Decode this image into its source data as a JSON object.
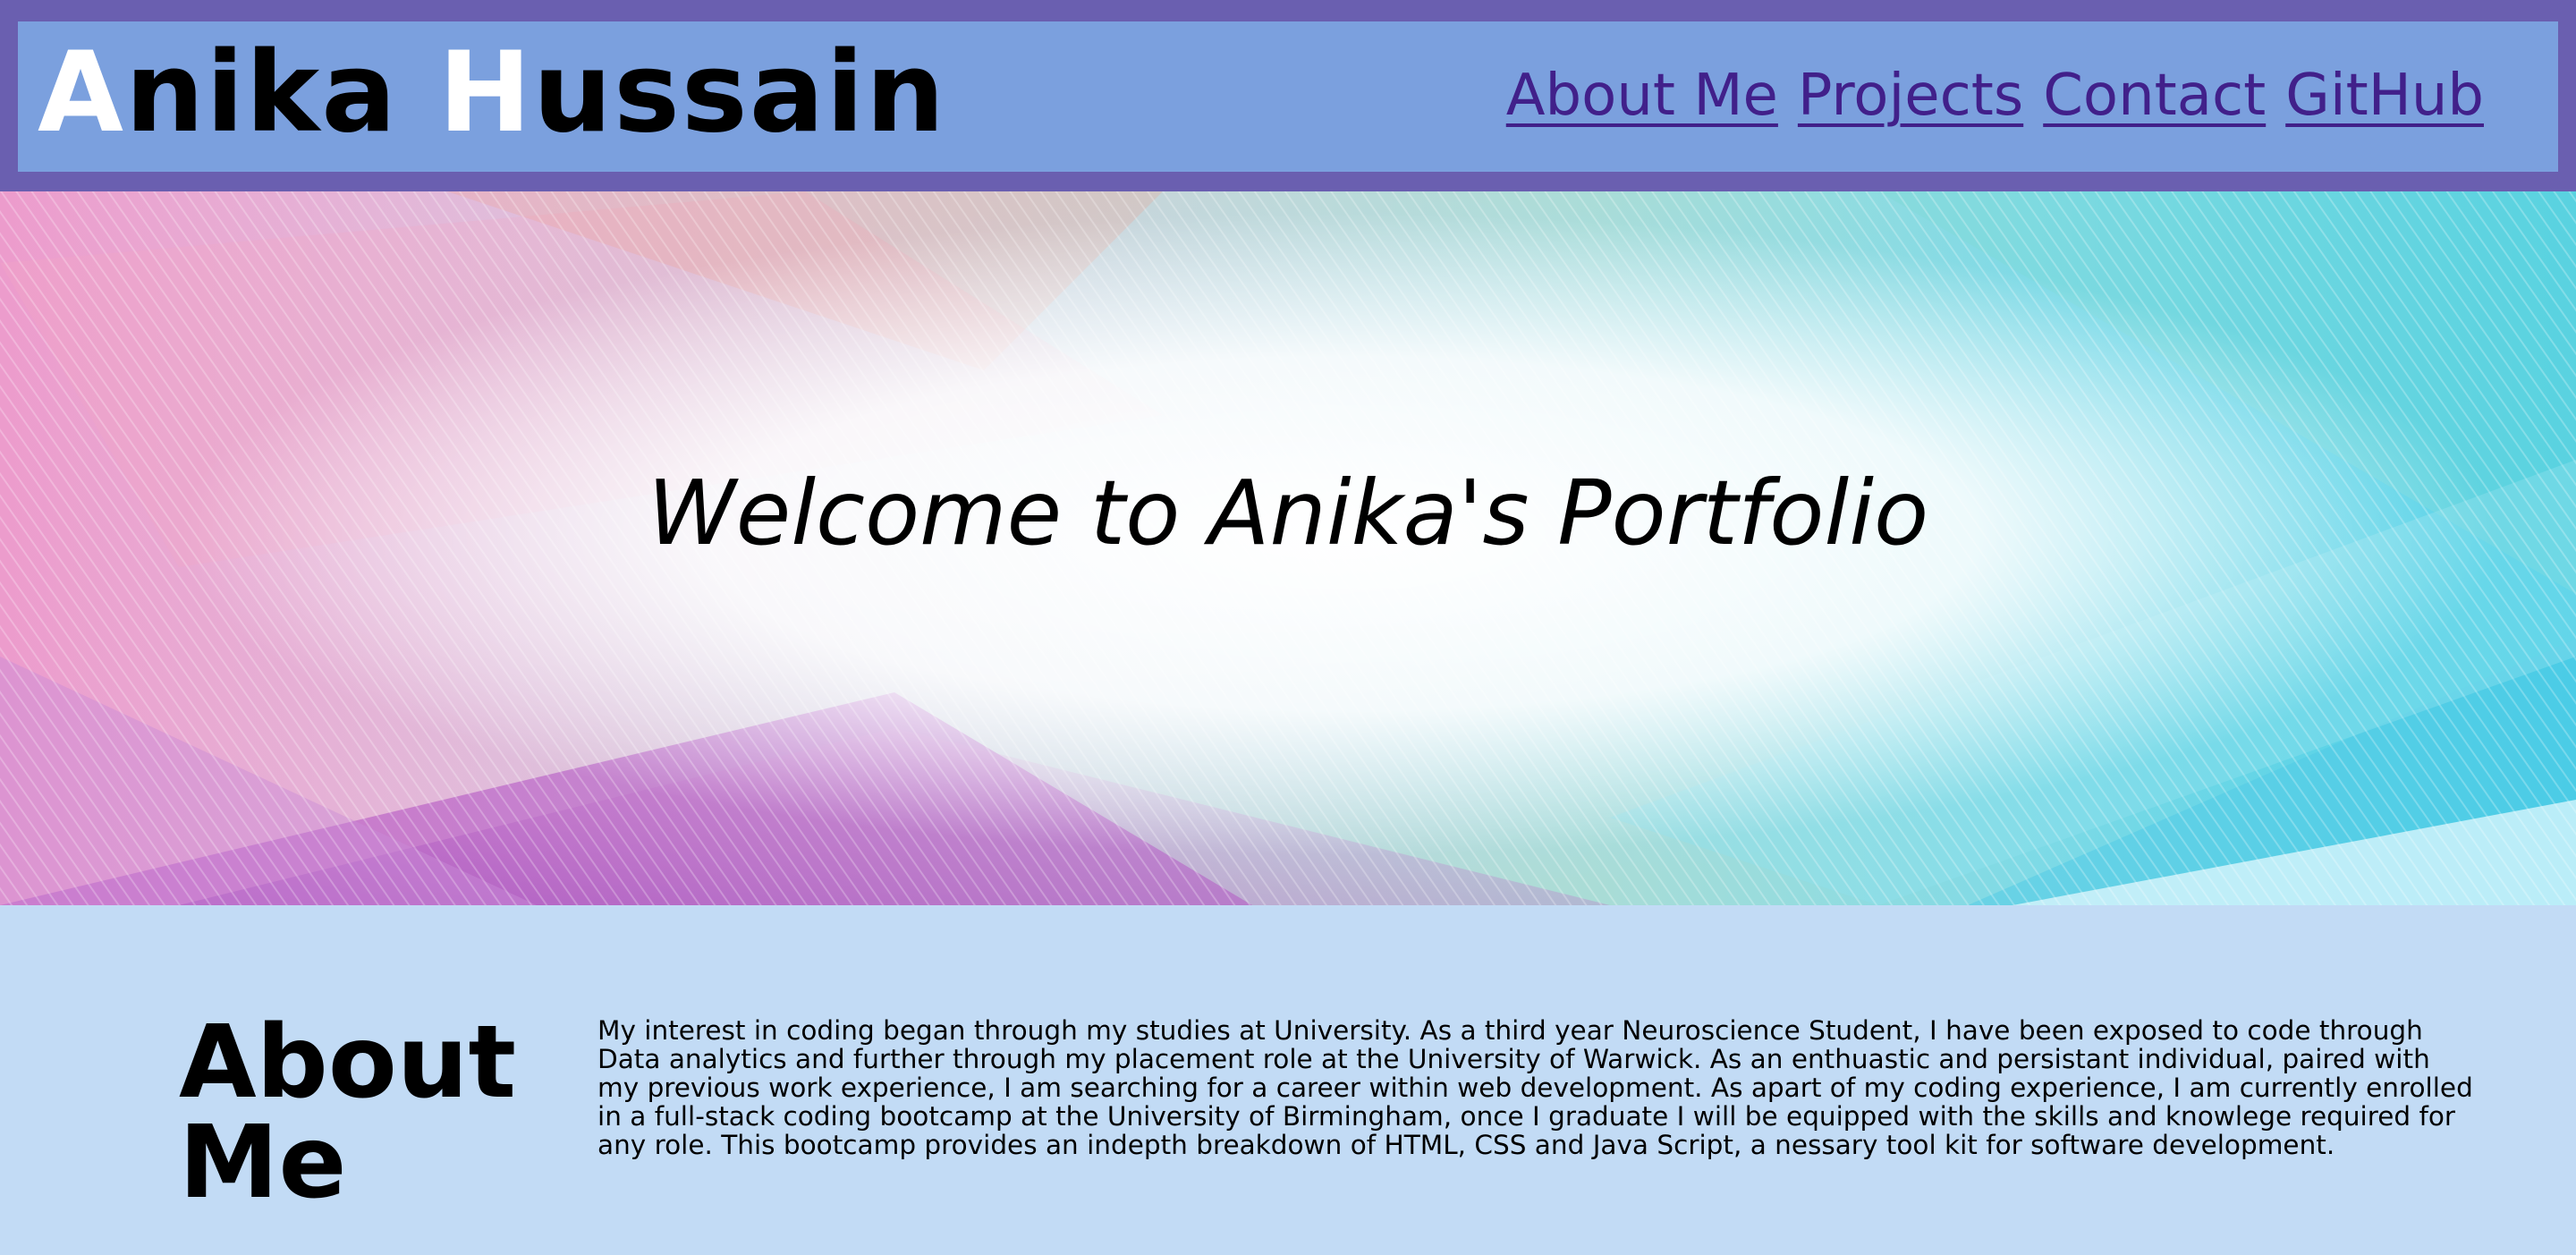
{
  "header": {
    "name_first_initial": "A",
    "name_first_rest": "nika ",
    "name_last_initial": "H",
    "name_last_rest": "ussain",
    "nav": [
      {
        "label": "About Me"
      },
      {
        "label": "Projects"
      },
      {
        "label": "Contact"
      },
      {
        "label": "GitHub"
      }
    ]
  },
  "hero": {
    "title": "Welcome to Anika's Portfolio"
  },
  "about": {
    "heading": "About Me",
    "body": "My interest in coding began through my studies at University. As a third year Neuroscience Student, I have been exposed to code through Data analytics and further through my placement role at the University of Warwick. As an enthuastic and persistant individual, paired with my previous work experience, I am searching for a career within web development. As apart of my coding experience, I am currently enrolled in a full-stack coding bootcamp at the University of Birmingham, once I graduate I will be equipped with the skills and knowlege required for any role. This bootcamp provides an indepth breakdown of HTML, CSS and Java Script, a nessary tool kit for software development."
  },
  "colors": {
    "header_border": "#6a5fb0",
    "header_bg": "#7ba0de",
    "nav_link": "#41208a",
    "section_bg": "#c2dbf5"
  }
}
